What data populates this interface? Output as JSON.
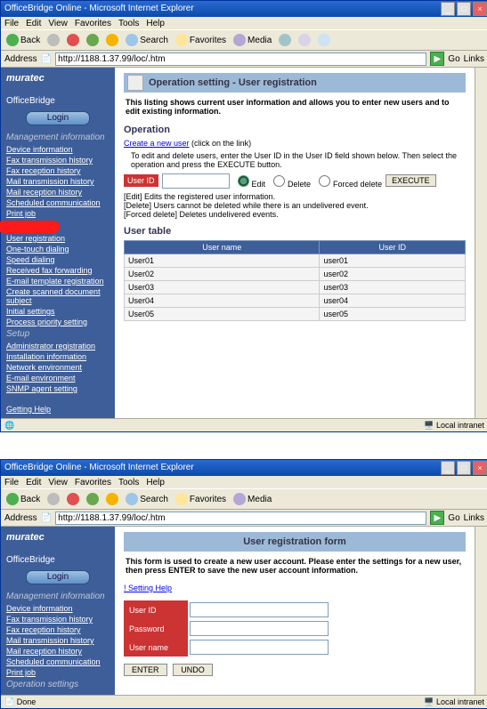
{
  "window": {
    "title": "OfficeBridge Online - Microsoft Internet Explorer",
    "min": "_",
    "max": "□",
    "close": "×"
  },
  "menu": {
    "file": "File",
    "edit": "Edit",
    "view": "View",
    "favorites": "Favorites",
    "tools": "Tools",
    "help": "Help"
  },
  "toolbar": {
    "back": "Back",
    "search": "Search",
    "favorites": "Favorites",
    "media": "Media"
  },
  "addr": {
    "label": "Address",
    "url": "http://1188.1.37.99/loc/.htm",
    "go": "Go",
    "links": "Links"
  },
  "sidebar": {
    "brand": "muratec",
    "brand2": "OfficeBridge",
    "login": "Login",
    "head1": "Management information",
    "items1": [
      "Device information",
      "Fax transmission history",
      "Fax reception history",
      "Mail transmission history",
      "Mail reception history",
      "Scheduled communication",
      "Print job"
    ],
    "head2": "Operation settings",
    "items2": [
      "User registration",
      "One-touch dialing",
      "Speed dialing",
      "Received fax forwarding",
      "E-mail template registration",
      "Create scanned document subject",
      "Initial settings",
      "Process priority setting"
    ],
    "head3": "Setup",
    "items3": [
      "Administrator registration",
      "Installation information",
      "Network environment",
      "E-mail environment",
      "SNMP agent setting"
    ],
    "help": "Getting Help"
  },
  "main1": {
    "heading": "Operation setting - User registration",
    "intro": "This listing shows current user information and allows you to enter new users and to edit existing information.",
    "op": "Operation",
    "create": "Create a new user",
    "create_suffix": " (click on the link)",
    "edel": "To edit and delete users, enter the User ID in the User ID field shown below. Then select the operation and press the EXECUTE button.",
    "userid": "User ID",
    "edit": "Edit",
    "delete": "Delete",
    "forced": "Forced delete",
    "execute": "EXECUTE",
    "note1": "[Edit] Edits the registered user information.",
    "note2": "[Delete] Users cannot be deleted while there is an undelivered event.",
    "note3": "[Forced delete] Deletes undelivered events.",
    "usertable": "User table",
    "col1": "User name",
    "col2": "User ID",
    "rows": [
      {
        "name": "User01",
        "id": "user01"
      },
      {
        "name": "User02",
        "id": "user02"
      },
      {
        "name": "User03",
        "id": "user03"
      },
      {
        "name": "User04",
        "id": "user04"
      },
      {
        "name": "User05",
        "id": "user05"
      }
    ]
  },
  "status": {
    "done": "Done",
    "zone": "Local intranet"
  },
  "main2": {
    "heading": "User registration form",
    "intro": "This form is used to create a new user account. Please enter the settings for a new user, then press ENTER to save the new user account information.",
    "help": "! Setting Help",
    "f1": "User ID",
    "f2": "Password",
    "f3": "User name",
    "enter": "ENTER",
    "undo": "UNDO"
  }
}
